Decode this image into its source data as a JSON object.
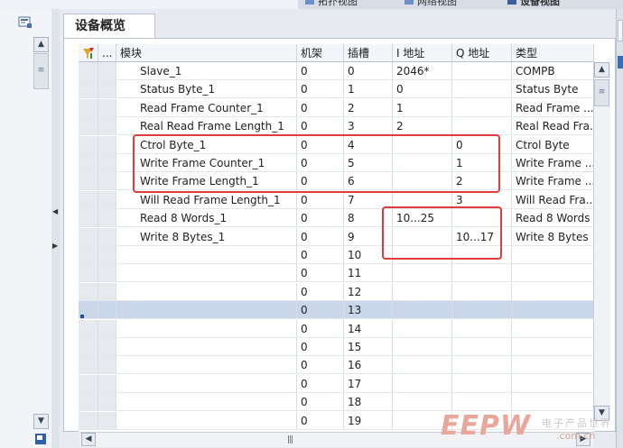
{
  "view_tabs": [
    "拓扑视图",
    "网络视图",
    "设备视图"
  ],
  "editor_tab": "设备概览",
  "columns": [
    {
      "key": "module",
      "label": "模块"
    },
    {
      "key": "rack",
      "label": "机架"
    },
    {
      "key": "slot",
      "label": "插槽"
    },
    {
      "key": "i_addr",
      "label": "I 地址"
    },
    {
      "key": "q_addr",
      "label": "Q 地址"
    },
    {
      "key": "type",
      "label": "类型"
    }
  ],
  "header_more": "...",
  "rows": [
    {
      "module": "Slave_1",
      "rack": "0",
      "slot": "0",
      "i_addr": "2046*",
      "q_addr": "",
      "type": "COMPB"
    },
    {
      "module": "Status Byte_1",
      "rack": "0",
      "slot": "1",
      "i_addr": "0",
      "q_addr": "",
      "type": "Status Byte"
    },
    {
      "module": "Read Frame Counter_1",
      "rack": "0",
      "slot": "2",
      "i_addr": "1",
      "q_addr": "",
      "type": "Read Frame ..."
    },
    {
      "module": "Real Read Frame Length_1",
      "rack": "0",
      "slot": "3",
      "i_addr": "2",
      "q_addr": "",
      "type": "Real Read Fra..."
    },
    {
      "module": "Ctrol Byte_1",
      "rack": "0",
      "slot": "4",
      "i_addr": "",
      "q_addr": "0",
      "type": "Ctrol Byte"
    },
    {
      "module": "Write Frame Counter_1",
      "rack": "0",
      "slot": "5",
      "i_addr": "",
      "q_addr": "1",
      "type": "Write Frame ..."
    },
    {
      "module": "Write Frame Length_1",
      "rack": "0",
      "slot": "6",
      "i_addr": "",
      "q_addr": "2",
      "type": "Write Frame ..."
    },
    {
      "module": "Will Read Frame Length_1",
      "rack": "0",
      "slot": "7",
      "i_addr": "",
      "q_addr": "3",
      "type": "Will Read Fra..."
    },
    {
      "module": "Read 8 Words_1",
      "rack": "0",
      "slot": "8",
      "i_addr": "10...25",
      "q_addr": "",
      "type": "Read 8 Words"
    },
    {
      "module": "Write 8 Bytes_1",
      "rack": "0",
      "slot": "9",
      "i_addr": "",
      "q_addr": "10...17",
      "type": "Write 8 Bytes"
    },
    {
      "module": "",
      "rack": "0",
      "slot": "10",
      "i_addr": "",
      "q_addr": "",
      "type": ""
    },
    {
      "module": "",
      "rack": "0",
      "slot": "11",
      "i_addr": "",
      "q_addr": "",
      "type": ""
    },
    {
      "module": "",
      "rack": "0",
      "slot": "12",
      "i_addr": "",
      "q_addr": "",
      "type": ""
    },
    {
      "module": "",
      "rack": "0",
      "slot": "13",
      "i_addr": "",
      "q_addr": "",
      "type": "",
      "selected": true
    },
    {
      "module": "",
      "rack": "0",
      "slot": "14",
      "i_addr": "",
      "q_addr": "",
      "type": ""
    },
    {
      "module": "",
      "rack": "0",
      "slot": "15",
      "i_addr": "",
      "q_addr": "",
      "type": ""
    },
    {
      "module": "",
      "rack": "0",
      "slot": "16",
      "i_addr": "",
      "q_addr": "",
      "type": ""
    },
    {
      "module": "",
      "rack": "0",
      "slot": "17",
      "i_addr": "",
      "q_addr": "",
      "type": ""
    },
    {
      "module": "",
      "rack": "0",
      "slot": "18",
      "i_addr": "",
      "q_addr": "",
      "type": ""
    },
    {
      "module": "",
      "rack": "0",
      "slot": "19",
      "i_addr": "",
      "q_addr": "",
      "type": ""
    }
  ],
  "highlight_color": "#e23b3b",
  "selection_color": "#cad6ea",
  "scroll_thumb_grip": "|||",
  "watermark": {
    "logo": "EEPW",
    "cn": "电子产品世界",
    "url": ".com.cn"
  },
  "icons": [
    "device-config-icon",
    "filter-icon",
    "scroll-up-icon",
    "scroll-down-icon",
    "scroll-left-icon",
    "scroll-right-icon"
  ]
}
